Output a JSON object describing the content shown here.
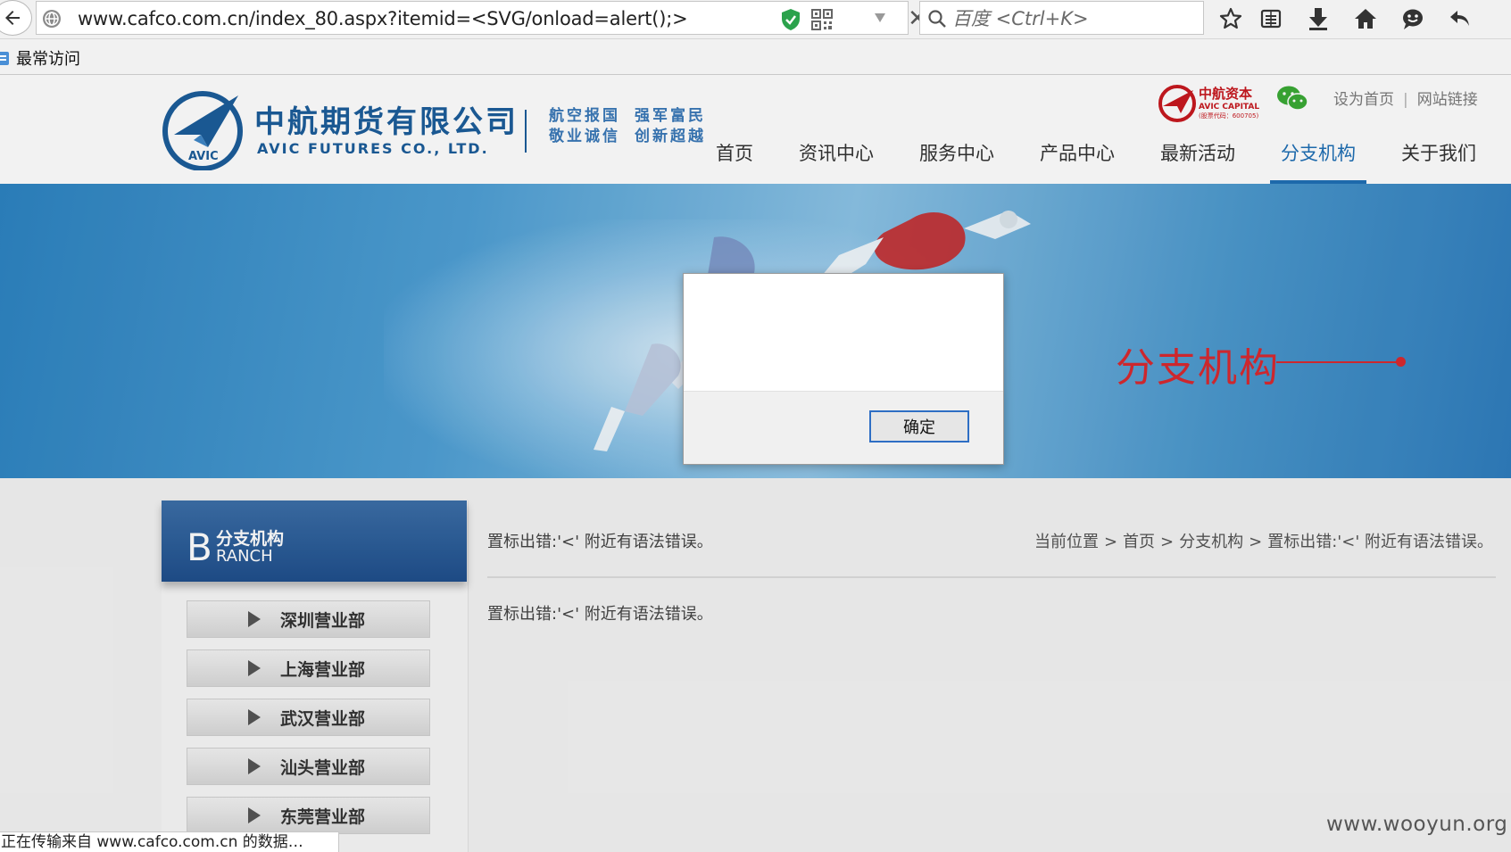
{
  "browser": {
    "url": "www.cafco.com.cn/index_80.aspx?itemid=<SVG/onload=alert();>",
    "search_placeholder": "百度 <Ctrl+K>",
    "bookmark_label": "最常访问",
    "status_text": "正在传输来自 www.cafco.com.cn 的数据…",
    "icons": [
      "back-icon",
      "globe-icon",
      "shield-icon",
      "qr-code-icon",
      "dropdown-icon",
      "stop-icon",
      "search-icon",
      "star-icon",
      "reading-list-icon",
      "download-icon",
      "home-icon",
      "chat-icon",
      "undo-icon",
      "bookmark-folder-icon"
    ]
  },
  "header": {
    "company_cn": "中航期货有限公司",
    "company_en": "AVIC FUTURES CO., LTD.",
    "logo_text": "AVIC",
    "slogan_line1": [
      "航空报国",
      "强军富民"
    ],
    "slogan_line2": [
      "敬业诚信",
      "创新超越"
    ],
    "capital_cn": "中航资本",
    "capital_en": "AVIC CAPITAL",
    "capital_code": "(股票代码：600705)",
    "toplinks": [
      "设为首页",
      "网站链接"
    ],
    "toplink_sep": "|",
    "nav": [
      "首页",
      "资讯中心",
      "服务中心",
      "产品中心",
      "最新活动",
      "分支机构",
      "关于我们"
    ],
    "nav_active": "分支机构"
  },
  "banner": {
    "title": "分支机构",
    "accent_color": "#d92a30"
  },
  "sidebar": {
    "big_letter": "B",
    "title_cn": "分支机构",
    "title_en": "RANCH",
    "items": [
      "深圳营业部",
      "上海营业部",
      "武汉营业部",
      "汕头营业部",
      "东莞营业部"
    ]
  },
  "main": {
    "error_text": "置标出错:'<' 附近有语法错误。",
    "breadcrumb": [
      "当前位置",
      "首页",
      "分支机构",
      "置标出错:'<' 附近有语法错误。"
    ],
    "breadcrumb_sep": ">",
    "body_text": "置标出错:'<' 附近有语法错误。"
  },
  "dialog": {
    "message": "",
    "ok_label": "确定"
  },
  "watermark": "www.wooyun.org"
}
